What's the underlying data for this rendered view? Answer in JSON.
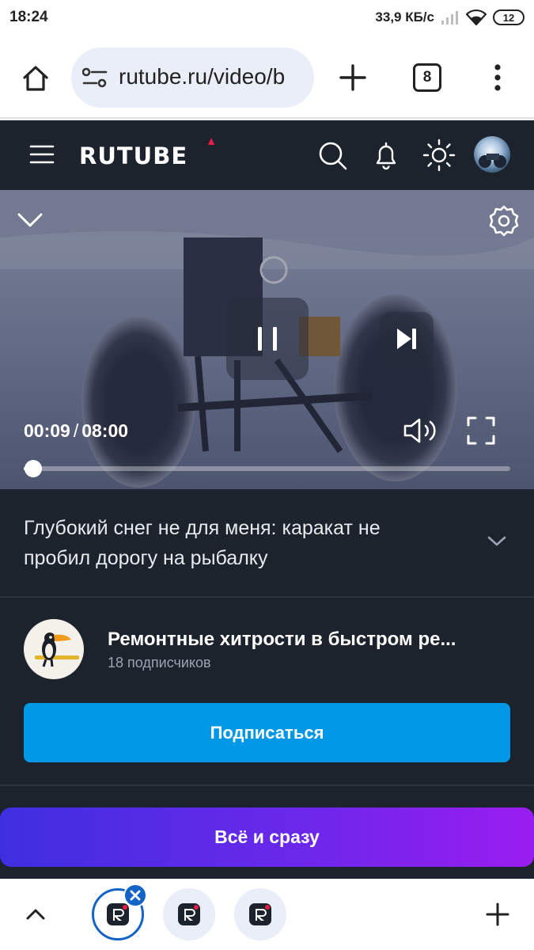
{
  "status_bar": {
    "time": "18:24",
    "network_speed": "33,9 КБ/с",
    "battery": "12"
  },
  "browser": {
    "url": "rutube.ru/video/b",
    "tab_count": "8"
  },
  "site": {
    "logo": "RUTUBE"
  },
  "player": {
    "current_time": "00:09",
    "duration": "08:00",
    "progress_fraction": 0.019
  },
  "video": {
    "title": "Глубокий снег не для меня: каракат не пробил дорогу на рыбалку"
  },
  "channel": {
    "name": "Ремонтные хитрости в быстром ре...",
    "subscribers": "18 подписчиков",
    "subscribe_label": "Подписаться"
  },
  "promo": {
    "label": "Всё и сразу"
  },
  "colors": {
    "site_background": "#1c232d",
    "subscribe_button": "#0097e6",
    "promo_gradient_start": "#3f2fe0",
    "promo_gradient_end": "#9a1df0",
    "active_tab_ring": "#1464c8"
  }
}
